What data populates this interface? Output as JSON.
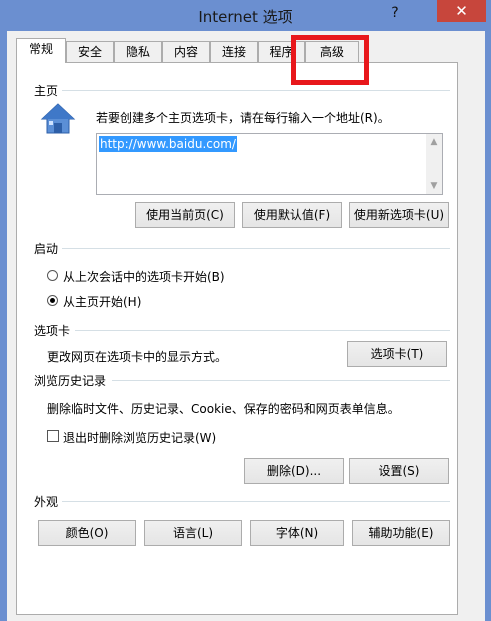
{
  "window": {
    "title": "Internet 选项",
    "help_symbol": "?",
    "close_symbol": "✕"
  },
  "tabs": [
    {
      "label": "常规",
      "active": true
    },
    {
      "label": "安全"
    },
    {
      "label": "隐私"
    },
    {
      "label": "内容"
    },
    {
      "label": "连接"
    },
    {
      "label": "程序"
    },
    {
      "label": "高级"
    }
  ],
  "homepage": {
    "section_label": "主页",
    "instruction": "若要创建多个主页选项卡，请在每行输入一个地址(R)。",
    "url_value": "http://www.baidu.com/",
    "buttons": {
      "use_current": "使用当前页(C)",
      "use_default": "使用默认值(F)",
      "use_new_tab": "使用新选项卡(U)"
    }
  },
  "startup": {
    "section_label": "启动",
    "option_last_session": "从上次会话中的选项卡开始(B)",
    "option_home_page": "从主页开始(H)",
    "selected": "home_page"
  },
  "tabs_section": {
    "section_label": "选项卡",
    "description": "更改网页在选项卡中的显示方式。",
    "button": "选项卡(T)"
  },
  "history": {
    "section_label": "浏览历史记录",
    "description": "删除临时文件、历史记录、Cookie、保存的密码和网页表单信息。",
    "checkbox_label": "退出时删除浏览历史记录(W)",
    "checkbox_checked": false,
    "delete_button": "删除(D)...",
    "settings_button": "设置(S)"
  },
  "appearance": {
    "section_label": "外观",
    "colors_button": "颜色(O)",
    "languages_button": "语言(L)",
    "fonts_button": "字体(N)",
    "accessibility_button": "辅助功能(E)"
  },
  "colors": {
    "title_bar": "#6b8fd0",
    "close_button": "#c7463c",
    "highlight_box": "#e8171b",
    "selection": "#3399ff"
  }
}
